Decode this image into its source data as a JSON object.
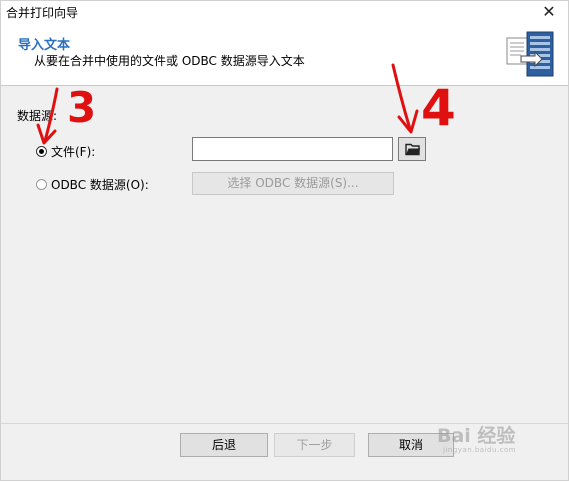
{
  "window": {
    "title": "合并打印向导",
    "close_label": "✕"
  },
  "header": {
    "title": "导入文本",
    "subtitle": "从要在合并中使用的文件或 ODBC 数据源导入文本"
  },
  "data_source": {
    "group_label": "数据源:",
    "file_option": {
      "label": "文件(F):",
      "checked": true,
      "value": ""
    },
    "odbc_option": {
      "label": "ODBC 数据源(O):",
      "checked": false,
      "button_label": "选择 ODBC 数据源(S)..."
    }
  },
  "footer": {
    "back_label": "后退",
    "next_label": "下一步",
    "cancel_label": "取消"
  },
  "annotations": {
    "step_a": "3",
    "step_b": "4"
  },
  "watermark": {
    "text": "Bai 经验",
    "subtext": "jingyan.baidu.com"
  },
  "colors": {
    "header_title": "#2b6fc1",
    "annotation": "#e01010"
  }
}
